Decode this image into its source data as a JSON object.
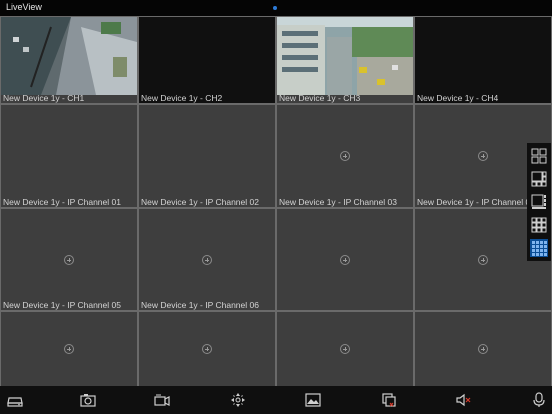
{
  "app": {
    "title": "LiveView"
  },
  "channels": [
    {
      "label": "New Device 1y - CH1",
      "state": "feed"
    },
    {
      "label": "New Device 1y - CH2",
      "state": "empty"
    },
    {
      "label": "New Device 1y - CH3",
      "state": "feed"
    },
    {
      "label": "New Device 1y - CH4",
      "state": "empty"
    },
    {
      "label": "New Device 1y - IP Channel 01",
      "state": "add"
    },
    {
      "label": "New Device 1y - IP Channel 02",
      "state": "add"
    },
    {
      "label": "New Device 1y - IP Channel 03",
      "state": "add"
    },
    {
      "label": "New Device 1y - IP Channel 04",
      "state": "add"
    },
    {
      "label": "New Device 1y - IP Channel 05",
      "state": "add"
    },
    {
      "label": "New Device 1y - IP Channel 06",
      "state": "add"
    },
    {
      "label": "",
      "state": "add"
    },
    {
      "label": "",
      "state": "add"
    },
    {
      "label": "",
      "state": "add"
    },
    {
      "label": "",
      "state": "add"
    },
    {
      "label": "",
      "state": "add"
    },
    {
      "label": "",
      "state": "add"
    }
  ],
  "layout_options": [
    {
      "icon": "layout-4-icon"
    },
    {
      "icon": "layout-6-icon"
    },
    {
      "icon": "layout-8-icon"
    },
    {
      "icon": "layout-9-icon"
    },
    {
      "icon": "layout-16-icon",
      "selected": true
    }
  ],
  "toolbar": [
    {
      "icon": "device-icon"
    },
    {
      "icon": "snapshot-icon"
    },
    {
      "icon": "record-icon"
    },
    {
      "icon": "ptz-icon"
    },
    {
      "icon": "image-icon"
    },
    {
      "icon": "close-all-icon"
    },
    {
      "icon": "mute-icon"
    },
    {
      "icon": "talk-icon"
    }
  ],
  "colors": {
    "accent": "#0b4e96",
    "cell": "#3e3e3e",
    "grid_line": "#6a6a6a"
  }
}
